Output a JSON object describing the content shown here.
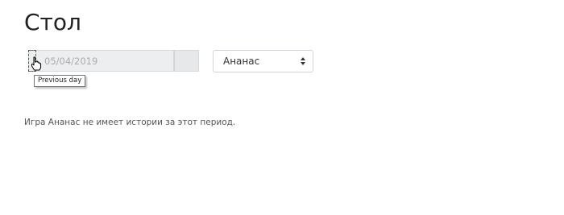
{
  "page": {
    "title": "Стол",
    "empty_message": "Игра Ананас не имеет истории за этот период."
  },
  "date_picker": {
    "value": "05/04/2019",
    "prev_tooltip": "Previous day"
  },
  "game_select": {
    "selected": "Ананас"
  },
  "icons": {
    "cursor": "hand-pointer-icon",
    "select_arrows": "sort-arrows-icon"
  },
  "colors": {
    "input_background": "#eceeef",
    "text_muted": "#a8adb2",
    "title": "#222222"
  }
}
